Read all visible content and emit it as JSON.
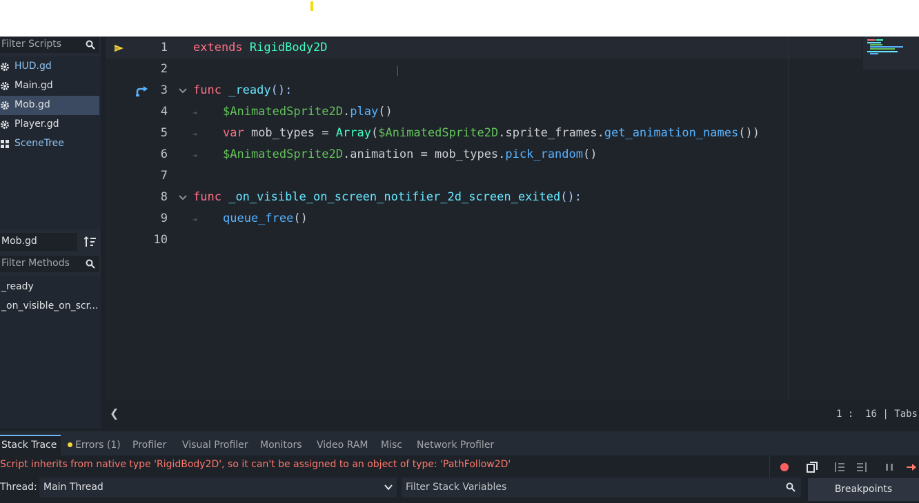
{
  "left_panel": {
    "filter_scripts_placeholder": "Filter Scripts",
    "scripts": [
      {
        "label": "HUD.gd"
      },
      {
        "label": "Main.gd"
      },
      {
        "label": "Mob.gd"
      },
      {
        "label": "Player.gd"
      },
      {
        "label": "SceneTree"
      }
    ],
    "selected_script": "Mob.gd",
    "current_script_name": "Mob.gd",
    "filter_methods_placeholder": "Filter Methods",
    "methods": [
      "_ready",
      "_on_visible_on_scr..."
    ]
  },
  "editor": {
    "line_numbers": [
      "1",
      "2",
      "3",
      "4",
      "5",
      "6",
      "7",
      "8",
      "9",
      "10"
    ],
    "code": {
      "l1_kw": "extends",
      "l1_type": "RigidBody2D",
      "l3_kw": "func",
      "l3_name": "_ready",
      "l3_rest": "():",
      "l4_node": "$AnimatedSprite2D",
      "l4_dot": ".",
      "l4_call": "play",
      "l4_paren": "()",
      "l5_kw": "var",
      "l5_mid": " mob_types = ",
      "l5_type": "Array",
      "l5_p1": "(",
      "l5_node": "$AnimatedSprite2D",
      "l5_prop": ".sprite_frames.",
      "l5_call": "get_animation_names",
      "l5_p2": "())",
      "l6_node": "$AnimatedSprite2D",
      "l6_mid": ".animation = mob_types.",
      "l6_call": "pick_random",
      "l6_paren": "()",
      "l8_kw": "func",
      "l8_name": "_on_visible_on_screen_notifier_2d_screen_exited",
      "l8_rest": "():",
      "l9_call": "queue_free",
      "l9_paren": "()"
    },
    "status": {
      "collapse_glyph": "❮",
      "cursor_position": "1 :  16 | Tabs"
    }
  },
  "bottom_panel": {
    "tabs": [
      {
        "label": "Stack Trace"
      },
      {
        "label": "Errors (1)"
      },
      {
        "label": "Profiler"
      },
      {
        "label": "Visual Profiler"
      },
      {
        "label": "Monitors"
      },
      {
        "label": "Video RAM"
      },
      {
        "label": "Misc"
      },
      {
        "label": "Network Profiler"
      }
    ],
    "error_message": "Script inherits from native type 'RigidBody2D', so it can't be assigned to an object of type: 'PathFollow2D'",
    "thread_label": "Thread:",
    "thread_value": "Main Thread",
    "stack_filter_placeholder": "Filter Stack Variables",
    "breakpoints_label": "Breakpoints"
  },
  "colors": {
    "accent": "#70bafa",
    "error": "#ff786b",
    "keyword": "#ff7085",
    "type": "#42ffc2",
    "function": "#57b3ff",
    "node_path": "#63c259"
  }
}
